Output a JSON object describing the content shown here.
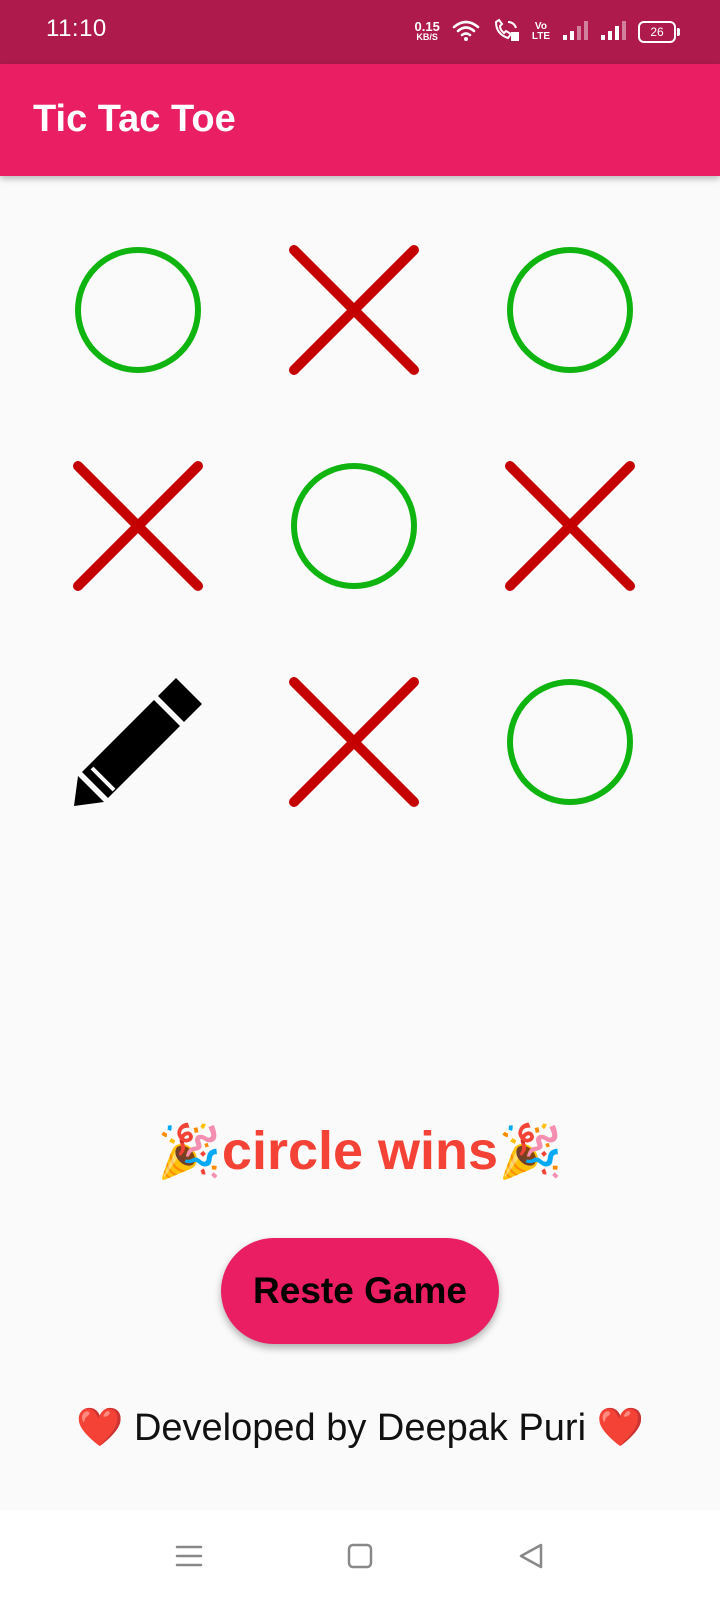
{
  "status_bar": {
    "time": "11:10",
    "net_speed_value": "0.15",
    "net_speed_unit": "KB/S",
    "volte_line1": "Vo",
    "volte_line2": "LTE",
    "battery": "26",
    "icons": [
      "wifi-icon",
      "wifi-calling-icon",
      "signal-icon",
      "signal-icon",
      "battery-icon"
    ]
  },
  "app_bar": {
    "title": "Tic Tac Toe"
  },
  "board": {
    "cells": [
      "O",
      "X",
      "O",
      "X",
      "O",
      "X",
      "pencil",
      "X",
      "O"
    ],
    "colors": {
      "circle": "#10b410",
      "cross": "#c40000",
      "pencil": "#000000"
    }
  },
  "result": {
    "text": "circle wins",
    "emoji": "🎉"
  },
  "reset_button": {
    "label": "Reste Game"
  },
  "credit": {
    "heart": "❤️",
    "text": " Developed by Deepak Puri "
  },
  "colors": {
    "status_bar": "#ad1a4b",
    "accent": "#e91e63",
    "result_text": "#f44336"
  }
}
